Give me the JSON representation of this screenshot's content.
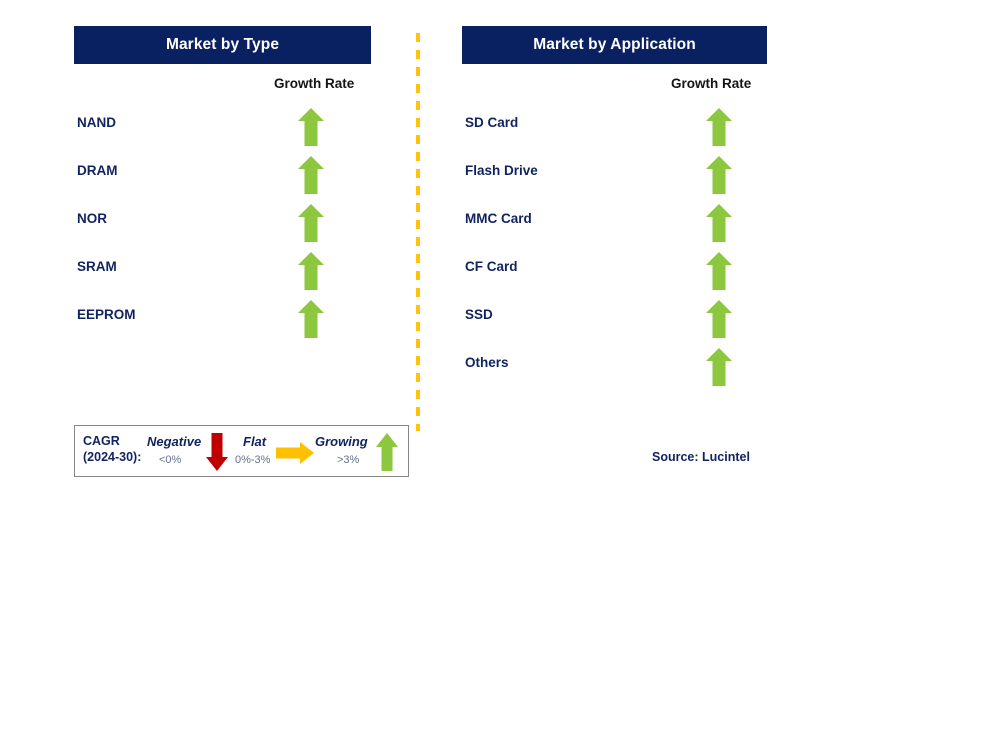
{
  "colors": {
    "header_bg": "#0A2161",
    "header_text": "#FFFFFF",
    "label_text": "#11235F",
    "growing_arrow": "#8DC63F",
    "negative_arrow": "#C00000",
    "flat_arrow": "#FFC000",
    "divider": "#FFC20E",
    "legend_border": "#868686",
    "background": "#FFFFFF"
  },
  "panels": [
    {
      "id": "market-by-type",
      "title": "Market by Type",
      "column_header": "Growth Rate",
      "rows": [
        {
          "label": "NAND",
          "growth": "Growing",
          "icon": "arrow-up-green-icon"
        },
        {
          "label": "DRAM",
          "growth": "Growing",
          "icon": "arrow-up-green-icon"
        },
        {
          "label": "NOR",
          "growth": "Growing",
          "icon": "arrow-up-green-icon"
        },
        {
          "label": "SRAM",
          "growth": "Growing",
          "icon": "arrow-up-green-icon"
        },
        {
          "label": "EEPROM",
          "growth": "Growing",
          "icon": "arrow-up-green-icon"
        }
      ]
    },
    {
      "id": "market-by-application",
      "title": "Market by Application",
      "column_header": "Growth Rate",
      "rows": [
        {
          "label": "SD Card",
          "growth": "Growing",
          "icon": "arrow-up-green-icon"
        },
        {
          "label": "Flash Drive",
          "growth": "Growing",
          "icon": "arrow-up-green-icon"
        },
        {
          "label": "MMC Card",
          "growth": "Growing",
          "icon": "arrow-up-green-icon"
        },
        {
          "label": "CF Card",
          "growth": "Growing",
          "icon": "arrow-up-green-icon"
        },
        {
          "label": "SSD",
          "growth": "Growing",
          "icon": "arrow-up-green-icon"
        },
        {
          "label": "Others",
          "growth": "Growing",
          "icon": "arrow-up-green-icon"
        }
      ]
    }
  ],
  "legend": {
    "title_line1": "CAGR",
    "title_line2": "(2024-30):",
    "items": [
      {
        "name": "Negative",
        "range": "<0%",
        "icon": "arrow-down-red-icon",
        "color": "#C00000"
      },
      {
        "name": "Flat",
        "range": "0%-3%",
        "icon": "arrow-right-amber-icon",
        "color": "#FFC000"
      },
      {
        "name": "Growing",
        "range": ">3%",
        "icon": "arrow-up-green-icon",
        "color": "#8DC63F"
      }
    ]
  },
  "source": "Source: Lucintel"
}
